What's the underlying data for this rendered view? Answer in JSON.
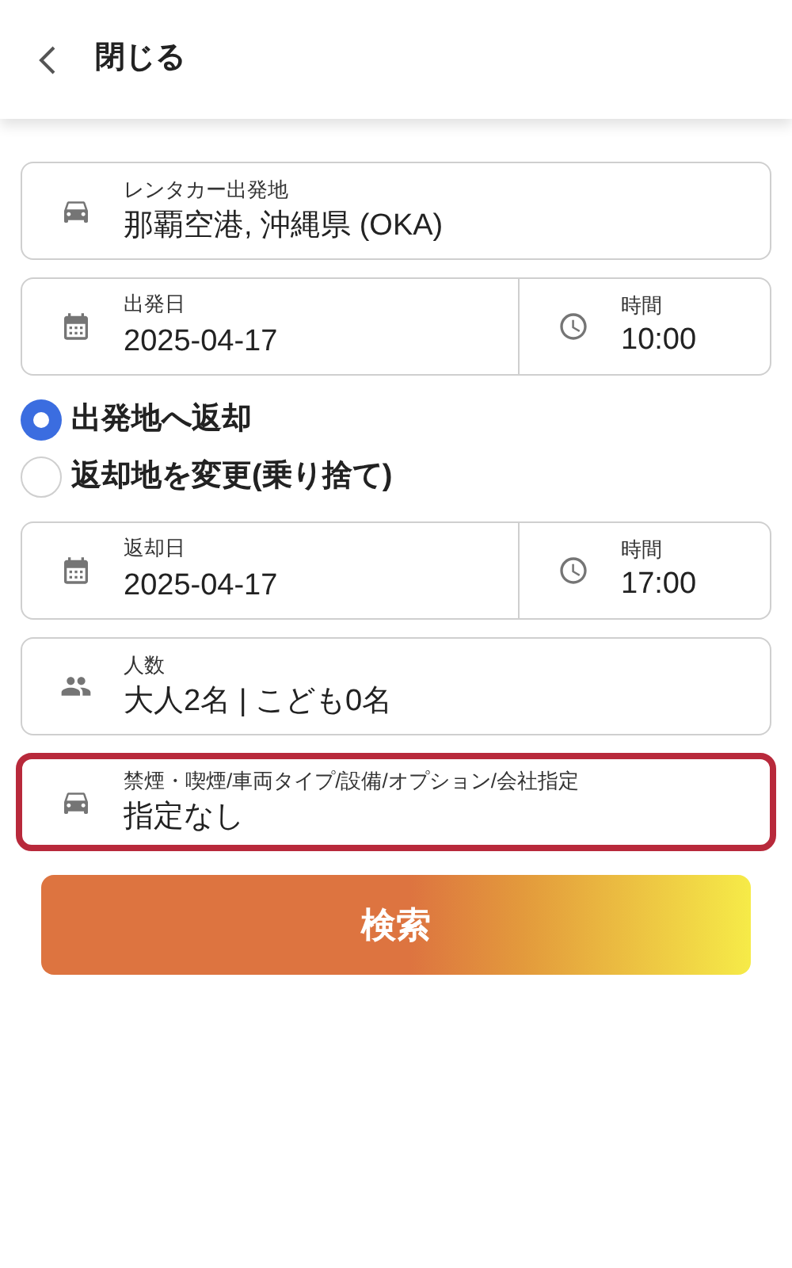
{
  "header": {
    "title": "閉じる"
  },
  "fields_top": [
    {
      "kind": "location",
      "label": "レンタカー出発地",
      "value": "那覇空港, 沖縄県 (OKA)",
      "highlighted": false
    },
    {
      "kind": "date_time",
      "label": "出発日",
      "value": "2025-04-17",
      "time_label": "時間",
      "time_value": "10:00",
      "highlighted": false
    }
  ],
  "return_options": [
    {
      "label": "出発地へ返却",
      "selected": true
    },
    {
      "label": "返却地を変更(乗り捨て)",
      "selected": false
    }
  ],
  "fields_bottom": [
    {
      "kind": "date_time",
      "label": "返却日",
      "value": "2025-04-17",
      "time_label": "時間",
      "time_value": "17:00",
      "highlighted": false
    },
    {
      "kind": "people",
      "label": "人数",
      "value": "大人2名 | こども0名",
      "highlighted": false
    },
    {
      "kind": "options",
      "label": "禁煙・喫煙/車両タイプ/設備/オプション/会社指定",
      "value": "指定なし",
      "highlighted": true
    }
  ],
  "search_button": "検索"
}
